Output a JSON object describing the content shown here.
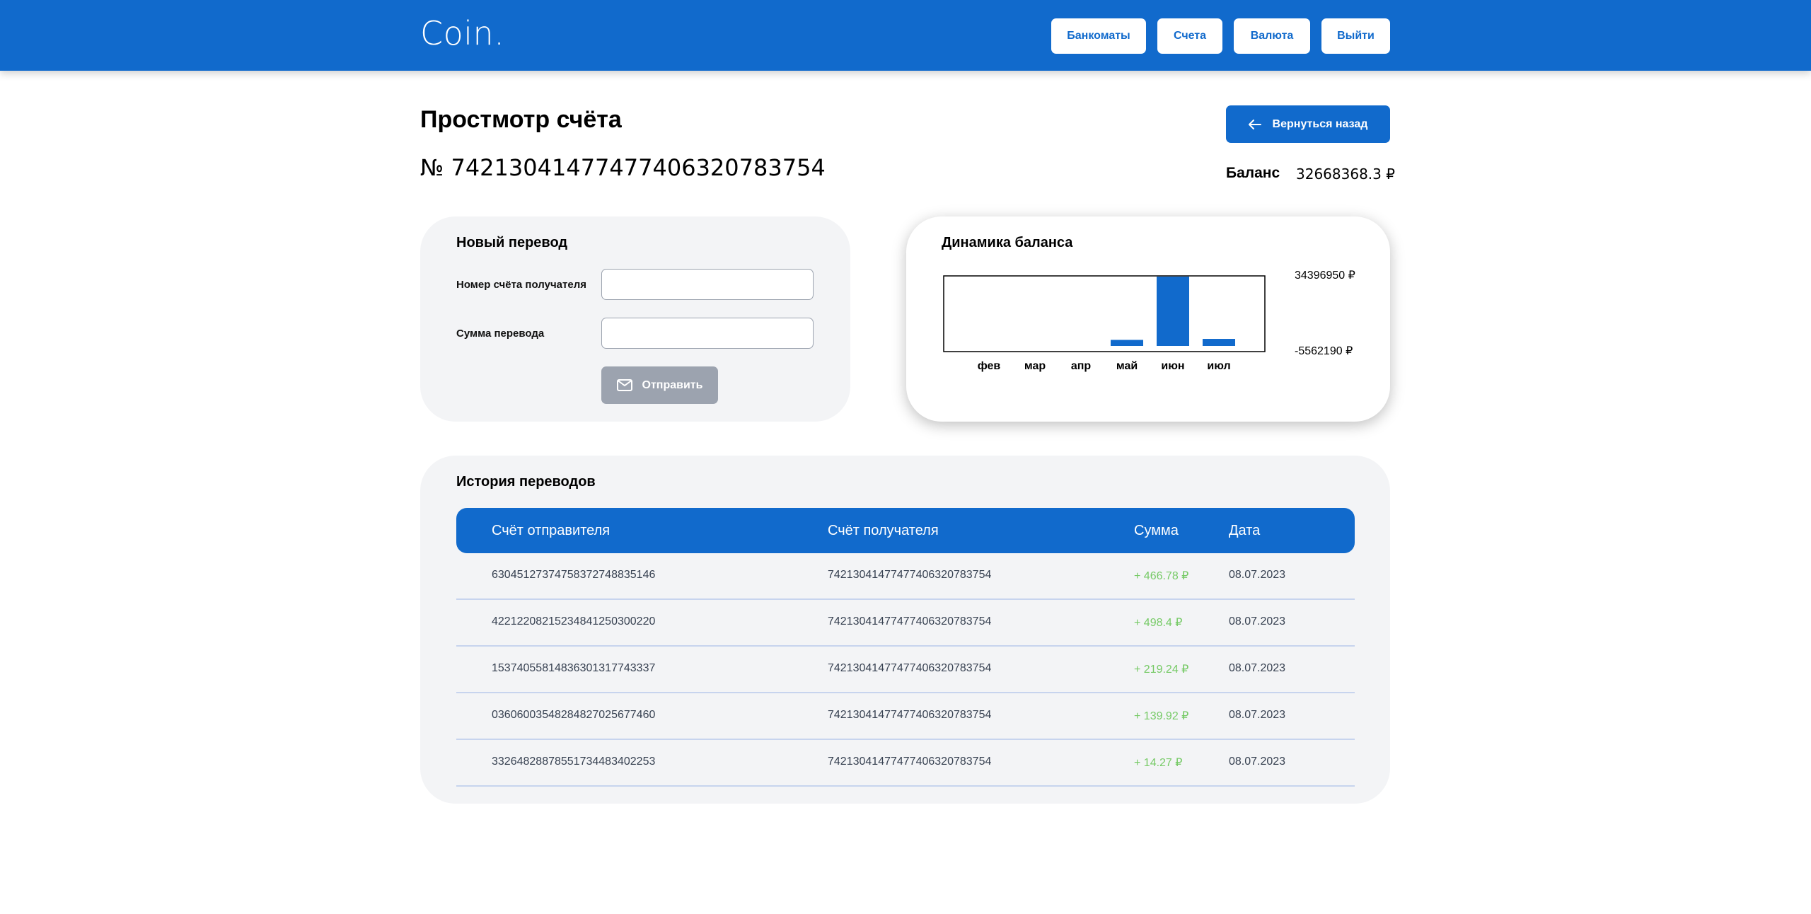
{
  "header": {
    "logo": "Coin.",
    "nav": {
      "atms": "Банкоматы",
      "accounts": "Счета",
      "currency": "Валюта",
      "logout": "Выйти"
    }
  },
  "page": {
    "title": "Простмотр счёта",
    "account_number": "№ 74213041477477406320783754",
    "back_label": "Вернуться назад",
    "balance_label": "Баланс",
    "balance_value": "32668368.3 ₽"
  },
  "transfer": {
    "title": "Новый перевод",
    "recipient_label": "Номер счёта получателя",
    "recipient_value": "",
    "amount_label": "Сумма перевода",
    "amount_value": "",
    "send_label": "Отправить"
  },
  "chart": {
    "title": "Динамика баланса",
    "max_label": "34396950 ₽",
    "min_label": "-5562190 ₽"
  },
  "chart_data": {
    "type": "bar",
    "title": "Динамика баланса",
    "categories": [
      "фев",
      "мар",
      "апр",
      "май",
      "июн",
      "июл"
    ],
    "values": [
      0,
      0,
      0,
      3000000,
      34396950,
      3500000
    ],
    "ylim": [
      -5562190,
      34396950
    ],
    "ytick_labels": [
      "34396950 ₽",
      "-5562190 ₽"
    ],
    "color": "#116ACC",
    "grid": false
  },
  "history": {
    "title": "История переводов",
    "columns": [
      "Счёт отправителя",
      "Счёт получателя",
      "Сумма",
      "Дата"
    ],
    "rows": [
      {
        "from": "63045127374758372748835146",
        "to": "74213041477477406320783754",
        "amount": "+ 466.78 ₽",
        "date": "08.07.2023"
      },
      {
        "from": "42212208215234841250300220",
        "to": "74213041477477406320783754",
        "amount": "+ 498.4 ₽",
        "date": "08.07.2023"
      },
      {
        "from": "15374055814836301317743337",
        "to": "74213041477477406320783754",
        "amount": "+ 219.24 ₽",
        "date": "08.07.2023"
      },
      {
        "from": "03606003548284827025677460",
        "to": "74213041477477406320783754",
        "amount": "+ 139.92 ₽",
        "date": "08.07.2023"
      },
      {
        "from": "33264828878551734483402253",
        "to": "74213041477477406320783754",
        "amount": "+ 14.27 ₽",
        "date": "08.07.2023"
      }
    ]
  },
  "colors": {
    "primary": "#116ACC",
    "card_bg": "#F3F4F6",
    "positive": "#76CA66",
    "disabled": "#9CA3AF"
  }
}
